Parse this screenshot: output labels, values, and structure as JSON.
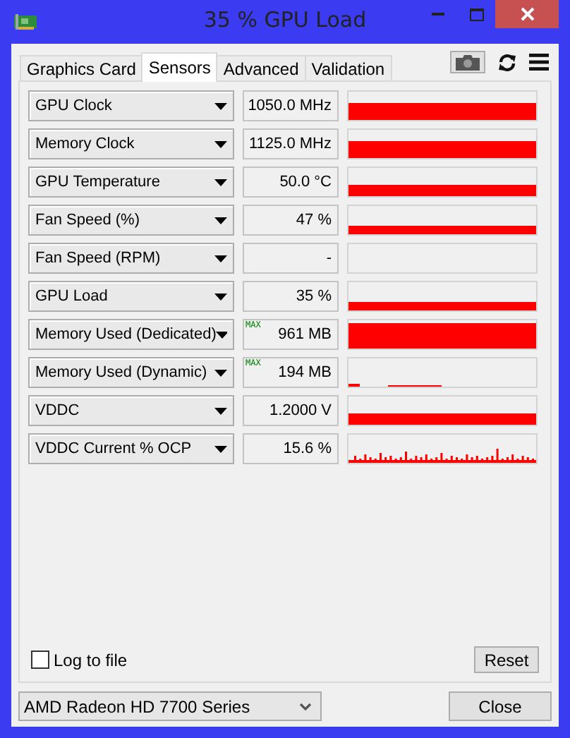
{
  "window": {
    "title": "35 % GPU Load"
  },
  "tabs": [
    {
      "label": "Graphics Card",
      "selected": false
    },
    {
      "label": "Sensors",
      "selected": true
    },
    {
      "label": "Advanced",
      "selected": false
    },
    {
      "label": "Validation",
      "selected": false
    }
  ],
  "sensors": [
    {
      "name": "GPU Clock",
      "value": "1050.0 MHz",
      "graph": {
        "kind": "high"
      }
    },
    {
      "name": "Memory Clock",
      "value": "1125.0 MHz",
      "graph": {
        "kind": "high"
      }
    },
    {
      "name": "GPU Temperature",
      "value": "50.0 °C",
      "graph": {
        "kind": "mid"
      }
    },
    {
      "name": "Fan Speed (%)",
      "value": "47 %",
      "graph": {
        "kind": "low"
      }
    },
    {
      "name": "Fan Speed (RPM)",
      "value": "-",
      "graph": {
        "kind": "empty"
      }
    },
    {
      "name": "GPU Load",
      "value": "35 %",
      "graph": {
        "kind": "low"
      }
    },
    {
      "name": "Memory Used (Dedicated)",
      "value": "961 MB",
      "tag": "MAX",
      "graph": {
        "kind": "full"
      }
    },
    {
      "name": "Memory Used (Dynamic)",
      "value": "194 MB",
      "tag": "MAX",
      "graph": {
        "kind": "step"
      }
    },
    {
      "name": "VDDC",
      "value": "1.2000 V",
      "graph": {
        "kind": "mid"
      }
    },
    {
      "name": "VDDC Current % OCP",
      "value": "15.6 %",
      "graph": {
        "kind": "spiky"
      }
    }
  ],
  "log_to_file": {
    "label": "Log to file",
    "checked": false
  },
  "reset_button": "Reset",
  "gpu_select": {
    "value": "AMD Radeon HD 7700 Series"
  },
  "close_button": "Close"
}
